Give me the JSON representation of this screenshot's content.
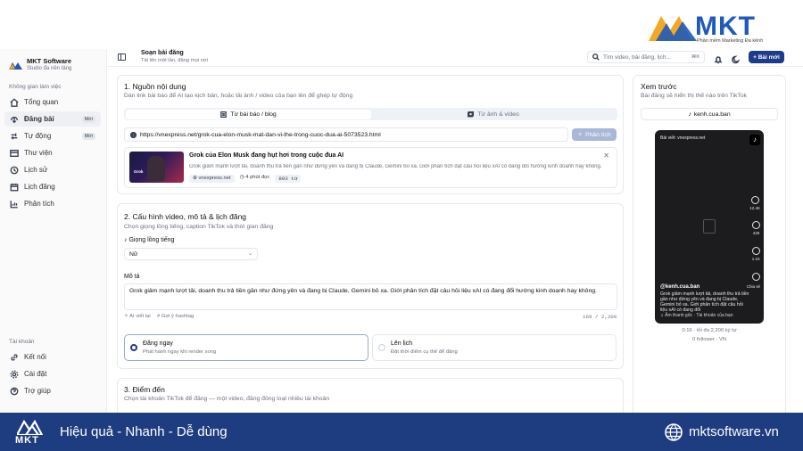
{
  "top_logo": {
    "text": "MKT",
    "tagline": "Phần mềm Marketing Đa kênh"
  },
  "sidebar": {
    "brand_name": "MKT Software",
    "brand_sub": "Studio đa nền tảng",
    "workspace_title": "Không gian làm việc",
    "items": [
      {
        "label": "Tổng quan",
        "icon": "home-icon"
      },
      {
        "label": "Đăng bài",
        "icon": "share-icon",
        "badge": "Mới",
        "active": true
      },
      {
        "label": "Tự động",
        "icon": "zap-icon",
        "badge": "Mới"
      },
      {
        "label": "Thư viện",
        "icon": "library-icon"
      },
      {
        "label": "Lịch sử",
        "icon": "history-icon"
      },
      {
        "label": "Lịch đăng",
        "icon": "calendar-icon"
      },
      {
        "label": "Phân tích",
        "icon": "chart-icon"
      }
    ],
    "account_title": "Tài khoản",
    "account_items": [
      {
        "label": "Kết nối",
        "icon": "link-icon"
      },
      {
        "label": "Cài đặt",
        "icon": "gear-icon"
      },
      {
        "label": "Trợ giúp",
        "icon": "help-icon"
      }
    ]
  },
  "header": {
    "title": "Soạn bài đăng",
    "subtitle": "Tải lên một lần, đăng mọi nơi",
    "search_placeholder": "Tìm video, bài đăng, lịch...",
    "search_shortcut": "⌘K",
    "new_post_label": "+ Bài mới"
  },
  "section1": {
    "title": "1. Nguồn nội dung",
    "subtitle": "Dán link bài báo để AI tạo kịch bản, hoặc tải ảnh / video của bạn lên để ghép tự động",
    "tab_article": "Từ bài báo / blog",
    "tab_media": "Từ ảnh & video",
    "url_value": "https://vnexpress.net/grok-cua-elon-musk-mat-dan-vi-the-trong-cuoc-dua-ai-5073523.html",
    "analyze_label": "Phân tích",
    "article": {
      "thumb_label": "Grok",
      "title": "Grok của Elon Musk đang hụt hơi trong cuộc đua AI",
      "desc": "Grok giảm mạnh lượt tải, doanh thu trả tiền gần như đứng yên và đang bị Claude, Gemini bỏ xa. Giới phân tích đặt câu hỏi liệu xAI có đang đổi hướng kinh doanh hay không.",
      "source": "vnexpress.net",
      "read_time": "4 phút đọc",
      "words": "893 từ"
    }
  },
  "section2": {
    "title": "2. Cấu hình video, mô tả & lịch đăng",
    "subtitle": "Chọn giọng lồng tiếng, caption TikTok và thời gian đăng",
    "voice_label": "Giọng lồng tiếng",
    "voice_value": "Nữ",
    "desc_label": "Mô tả",
    "desc_value": "Grok giảm mạnh lượt tải, doanh thu trả tiền gần như đứng yên và đang bị Claude, Gemini bỏ xa. Giới phân tích đặt câu hỏi liệu xAI có đang đổi hướng kinh doanh hay không.",
    "ai_write": "AI viết lại",
    "hashtag": "Gợi ý hashtag",
    "char_count": "169 / 2,200",
    "publish_now": "Đăng ngay",
    "publish_now_sub": "Phát hành ngay khi render xong",
    "schedule": "Lên lịch",
    "schedule_sub": "Đặt thời điểm cụ thể để đăng"
  },
  "section3": {
    "title": "3. Điểm đến",
    "subtitle": "Chọn tài khoản TikTok để đăng — một video, đăng đồng loạt nhiều tài khoản"
  },
  "preview": {
    "title": "Xem trước",
    "subtitle": "Bài đăng sẽ hiển thị thế nào trên TikTok",
    "account": "kenh.cua.ban",
    "phone_label": "Bài viết: vnexpress.net",
    "likes": "12.4K",
    "comments": "428",
    "saves": "1.1K",
    "share": "Chia sẻ",
    "handle": "@kenh.cua.ban",
    "caption": "Grok giảm mạnh lượt tải, doanh thu trả tiền gần như đứng yên và đang bị Claude, Gemini bỏ xa. Giới phân tích đặt câu hỏi liệu xAI có đang đổi",
    "sound": "♫ Âm thanh gốc · Tài khoản của bạn",
    "duration": "0:16 · tối đa 2,200 ký tự",
    "followers": "0 follower · VN"
  },
  "banner": {
    "logo_text": "MKT",
    "slogan": "Hiệu quả - Nhanh - Dễ dùng",
    "website": "mktsoftware.vn"
  },
  "colors": {
    "primary": "#1e3a8a",
    "banner": "#1e3c80",
    "logo_orange": "#f5a623",
    "logo_blue": "#1e5bb8"
  }
}
